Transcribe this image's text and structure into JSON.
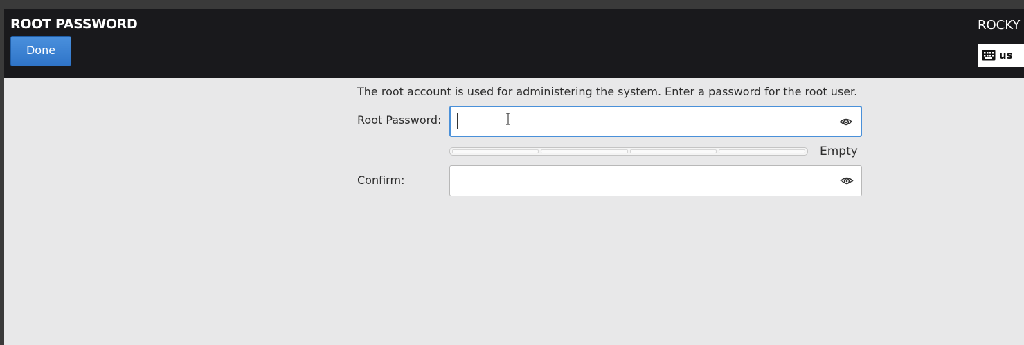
{
  "header": {
    "title": "ROOT PASSWORD",
    "done_label": "Done",
    "product": "ROCKY",
    "keyboard_layout": "us"
  },
  "main": {
    "description": "The root account is used for administering the system.  Enter a password for the root user.",
    "root_password": {
      "label": "Root Password:",
      "value": "",
      "focused": true
    },
    "strength": {
      "label": "Empty",
      "level": 0
    },
    "confirm": {
      "label": "Confirm:",
      "value": ""
    }
  },
  "colors": {
    "header_bg": "#19191c",
    "content_bg": "#e8e8e9",
    "accent": "#3584e4"
  },
  "icons": {
    "keyboard": "keyboard-icon",
    "show_password": "eye-icon"
  }
}
